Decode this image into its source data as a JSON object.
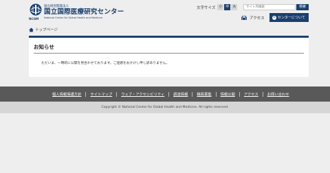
{
  "header": {
    "logo": {
      "org_small": "国立研究開発法人",
      "org_name": "国立国際医療研究センター",
      "org_en": "National Center for Global Health and Medicine",
      "abbr": "NCGM"
    },
    "font_size": {
      "label": "文字サイズ",
      "options": [
        "小",
        "中",
        "大"
      ],
      "selected": "中"
    },
    "search": {
      "placeholder": "サイト内検索",
      "button_label": "検索"
    },
    "access_label": "アクセス",
    "about_label": "センターについて"
  },
  "breadcrumb": {
    "home_label": "トップページ"
  },
  "main": {
    "title": "お知らせ",
    "message": "ただいま、一時的に公開を見合わせております。ご迷惑をおかけし申し訳ありません。"
  },
  "footer": {
    "links": [
      "個人情報保護方針",
      "サイトマップ",
      "ウェブ・アクセシビリティ",
      "調達情報",
      "職員募集",
      "情報公開",
      "アクセス",
      "お問い合わせ"
    ],
    "copyright": "Copyright © National Center for Global Health and Medicine. All rights reserved."
  },
  "colors": {
    "brand": "#1a3f6e",
    "footer_bg": "#595959",
    "copyright_bg": "#d6d6d6",
    "page_bg": "#eeeeee"
  }
}
